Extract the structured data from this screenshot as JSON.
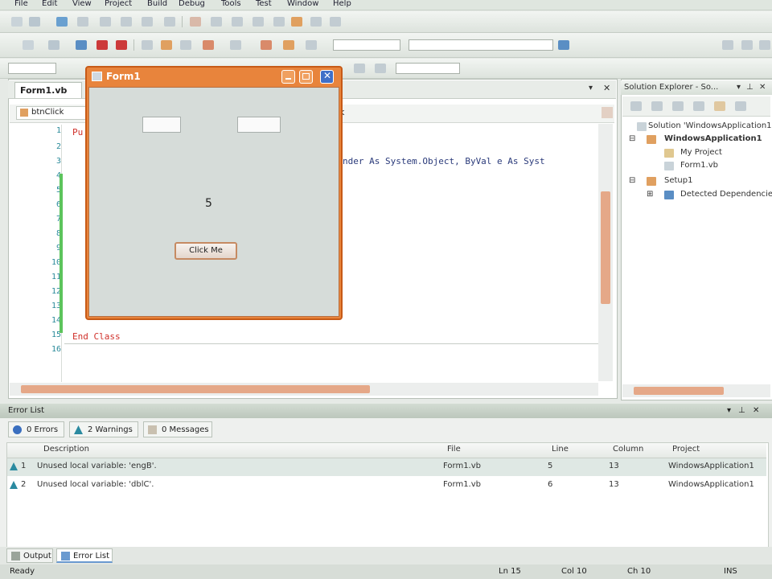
{
  "menu": [
    "File",
    "Edit",
    "View",
    "Project",
    "Build",
    "Debug",
    "Tools",
    "Test",
    "Window",
    "Help"
  ],
  "editor": {
    "tab_label": "Form1.vb",
    "nav_left": "btnClick",
    "nav_right_fragment": "k",
    "line_numbers": [
      "1",
      "2",
      "3",
      "4",
      "5",
      "6",
      "7",
      "8",
      "9",
      "10",
      "11",
      "12",
      "13",
      "14",
      "15",
      "16"
    ],
    "code_line_first": "Pu",
    "code_line_sub": "nder As System.Object, ByVal e As Syst",
    "code_line_end": "End Class"
  },
  "form_window": {
    "title": "Form1",
    "label_value": "5",
    "button_label": "Click Me"
  },
  "solution_explorer": {
    "title": "Solution Explorer - So...",
    "items": [
      "Solution 'WindowsApplication1'",
      "WindowsApplication1",
      "My Project",
      "Form1.vb",
      "Setup1",
      "Detected Dependencies"
    ]
  },
  "error_list": {
    "title": "Error List",
    "filters": [
      "0 Errors",
      "2 Warnings",
      "0 Messages"
    ],
    "columns": [
      "Description",
      "File",
      "Line",
      "Column",
      "Project"
    ],
    "rows": [
      {
        "num": "1",
        "description": "Unused local variable: 'engB'.",
        "file": "Form1.vb",
        "line": "5",
        "column": "13",
        "project": "WindowsApplication1"
      },
      {
        "num": "2",
        "description": "Unused local variable: 'dblC'.",
        "file": "Form1.vb",
        "line": "6",
        "column": "13",
        "project": "WindowsApplication1"
      }
    ]
  },
  "bottom_tabs": [
    "Output",
    "Error List"
  ],
  "status": {
    "left": "Ready",
    "ln": "Ln 15",
    "col": "Col 10",
    "ch": "Ch 10",
    "mode": "INS"
  },
  "colors": {
    "form_titlebar": "#e8843c",
    "keyword": "#d0302a",
    "line_number": "#2a8a9a",
    "change_bar": "#5cc45c"
  }
}
